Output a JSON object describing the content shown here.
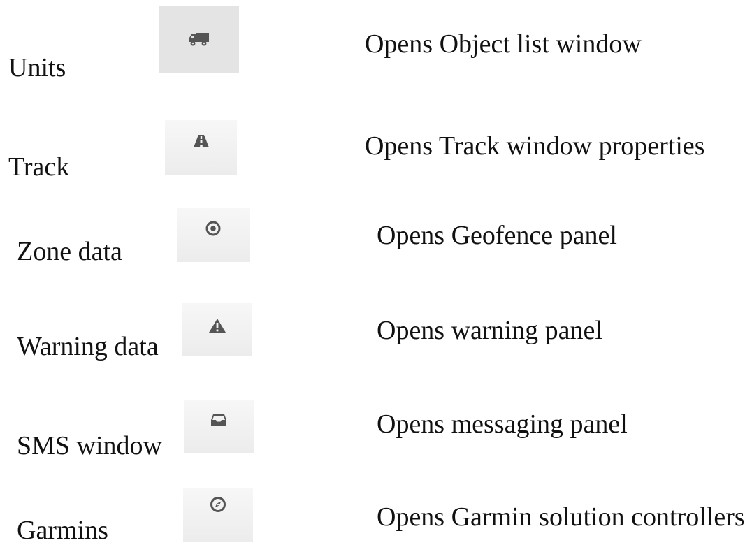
{
  "rows": [
    {
      "label": "Units",
      "icon": "truck-icon",
      "description": "Opens Object list window"
    },
    {
      "label": "Track",
      "icon": "road-icon",
      "description": "Opens Track window properties"
    },
    {
      "label": "Zone data",
      "icon": "target-icon",
      "description": "Opens Geofence panel"
    },
    {
      "label": "Warning data",
      "icon": "warning-icon",
      "description": "Opens warning panel"
    },
    {
      "label": "SMS window",
      "icon": "inbox-icon",
      "description": "Opens messaging panel"
    },
    {
      "label": "Garmins",
      "icon": "compass-icon",
      "description": "Opens Garmin solution controllers"
    }
  ],
  "colors": {
    "icon": "#555555",
    "button_bg": "#eeeeee",
    "text": "#111111"
  }
}
